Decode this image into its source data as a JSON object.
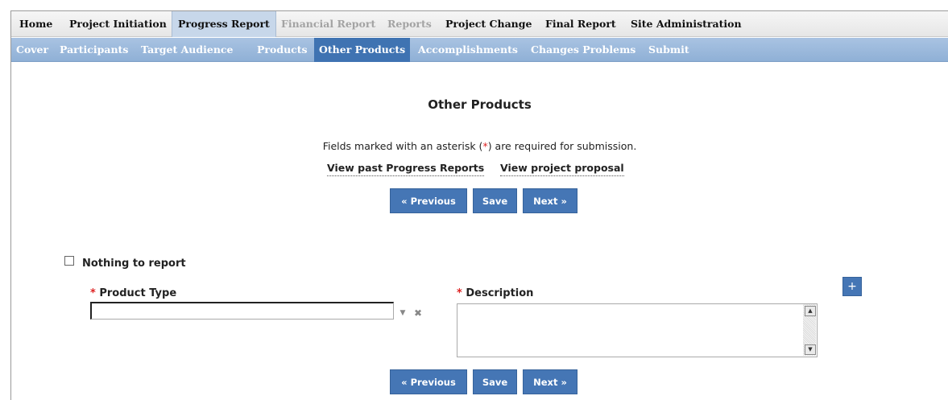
{
  "top_nav": {
    "items": [
      {
        "label": "Home"
      },
      {
        "label": "Project Initiation"
      },
      {
        "label": "Progress Report"
      },
      {
        "label": "Financial Report"
      },
      {
        "label": "Reports"
      },
      {
        "label": "Project Change"
      },
      {
        "label": "Final Report"
      },
      {
        "label": "Site Administration"
      }
    ],
    "active": "Progress Report",
    "disabled": [
      "Financial Report",
      "Reports"
    ]
  },
  "sub_nav": {
    "items": [
      {
        "label": "Cover"
      },
      {
        "label": "Participants"
      },
      {
        "label": "Target Audience"
      },
      {
        "label": "Products"
      },
      {
        "label": "Other Products"
      },
      {
        "label": "Accomplishments"
      },
      {
        "label": "Changes Problems"
      },
      {
        "label": "Submit"
      }
    ],
    "active": "Other Products"
  },
  "page": {
    "title": "Other Products",
    "required_note_before": "Fields marked with an asterisk (",
    "required_star": "*",
    "required_note_after": ") are required for submission.",
    "link_past_reports": "View past Progress Reports",
    "link_proposal": "View project proposal"
  },
  "buttons": {
    "previous": "« Previous",
    "save": "Save",
    "next": "Next »",
    "add": "+"
  },
  "form": {
    "nothing_to_report": "Nothing to report",
    "nothing_to_report_checked": false,
    "required_star": "*",
    "product_type_label": "Product Type",
    "product_type_value": "",
    "description_label": "Description",
    "description_value": ""
  },
  "colors": {
    "accent": "#4576b5",
    "subnav_bg": "#9fbbdd",
    "required": "#dd2222"
  }
}
